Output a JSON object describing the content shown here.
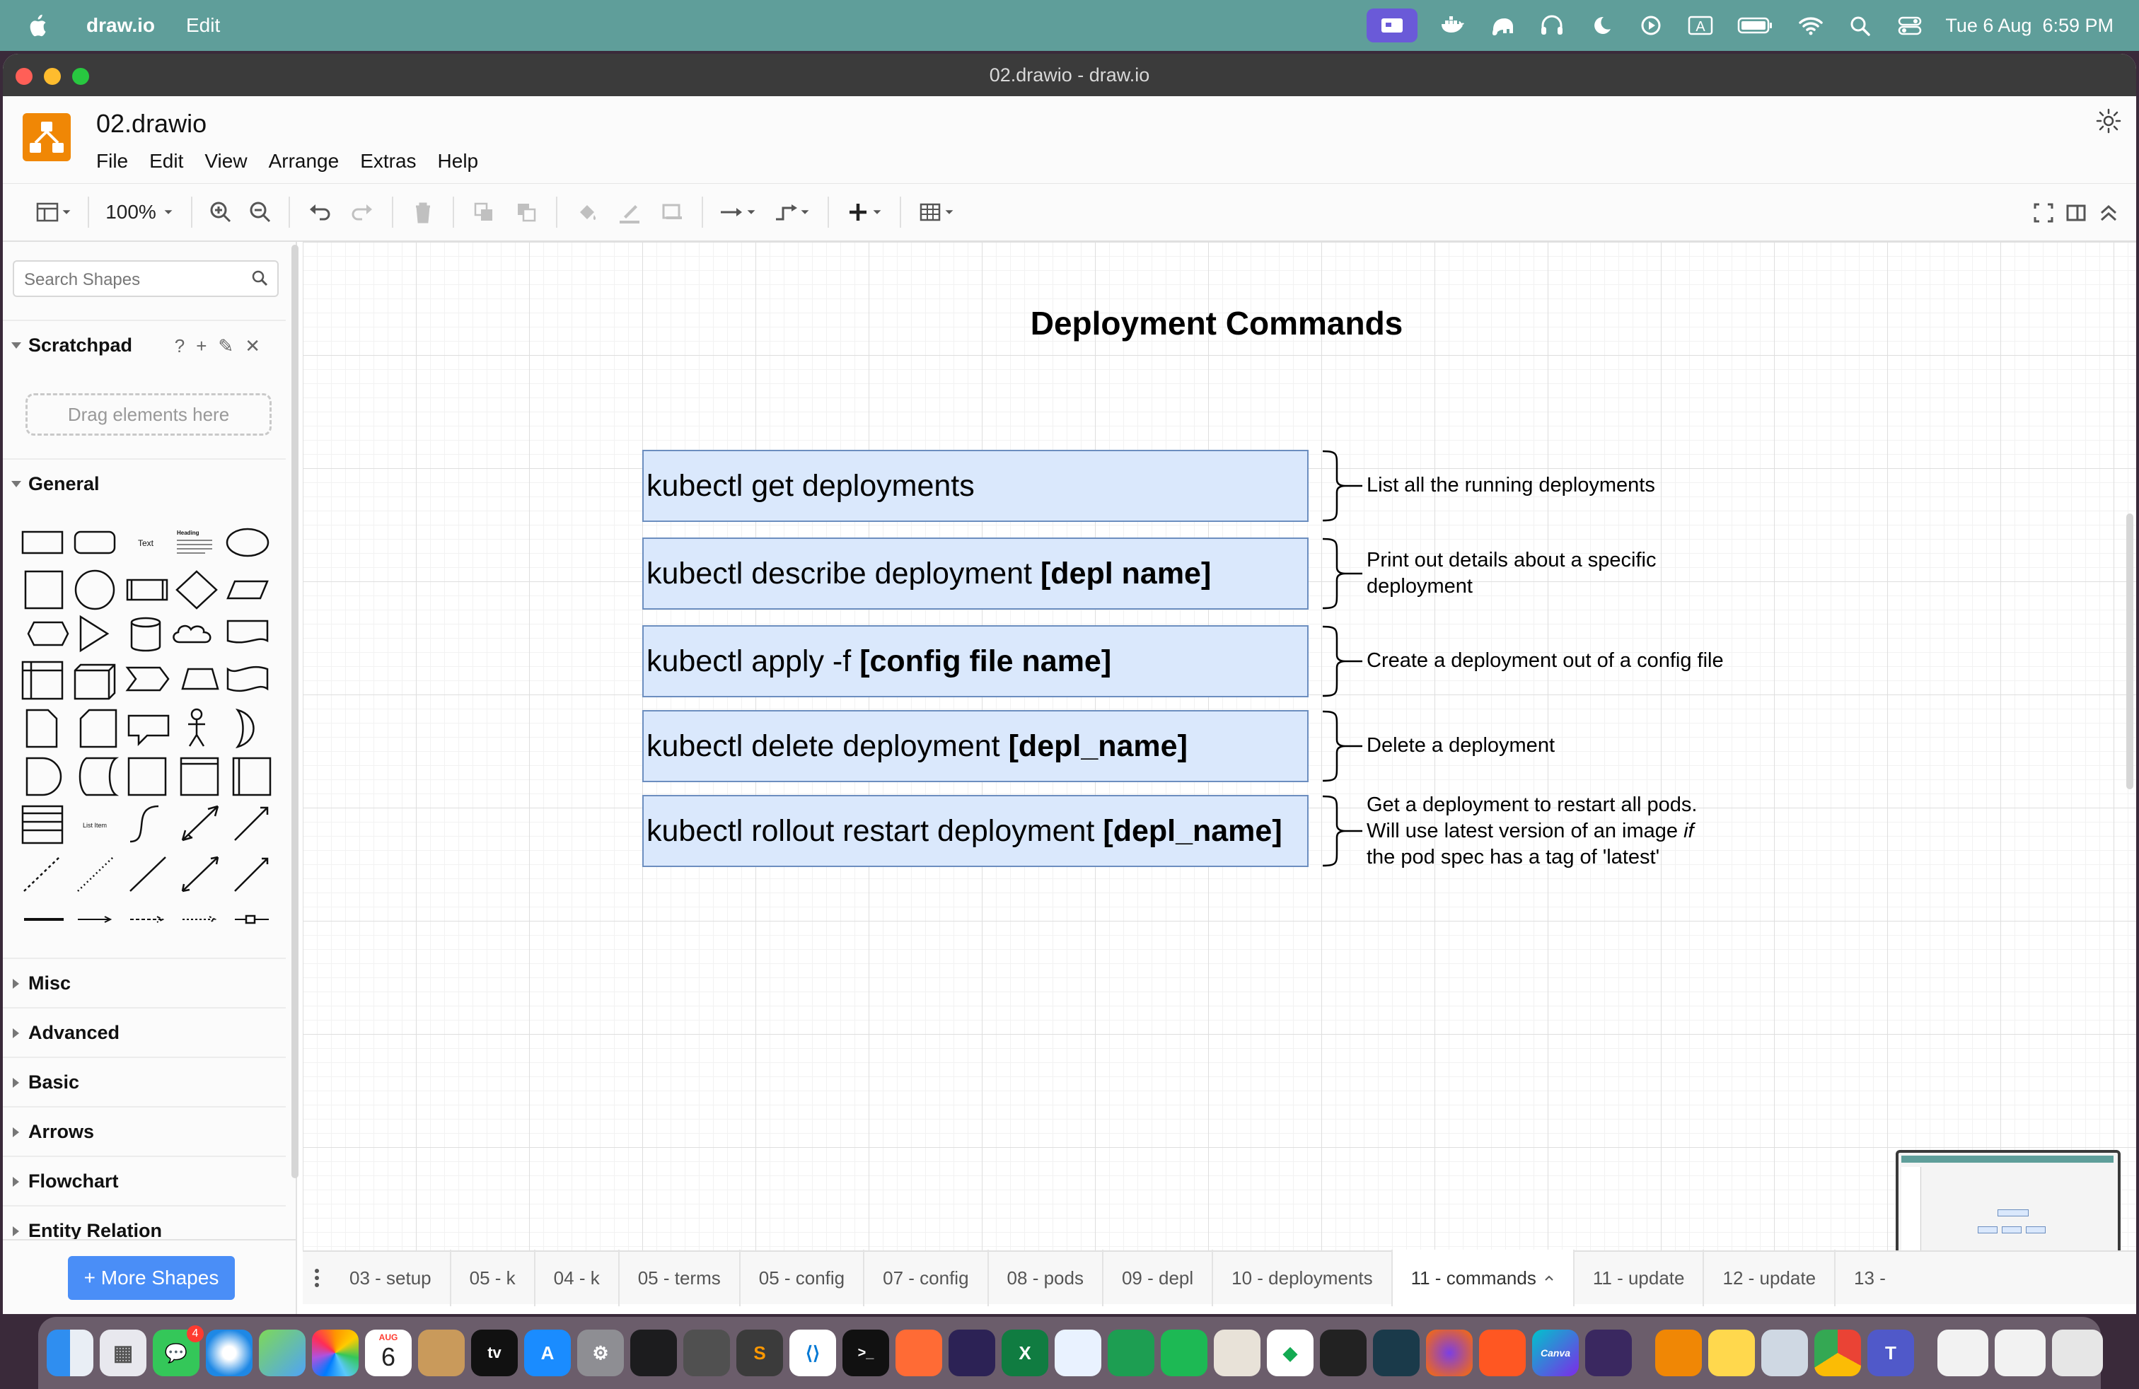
{
  "menubar": {
    "app_name": "draw.io",
    "edit": "Edit",
    "keyboard_indicator": "A",
    "datetime": "Tue 6 Aug  6:59 PM"
  },
  "window": {
    "title": "02.drawio - draw.io"
  },
  "app": {
    "doc_title": "02.drawio",
    "menu": [
      "File",
      "Edit",
      "View",
      "Arrange",
      "Extras",
      "Help"
    ],
    "zoom": "100%"
  },
  "sidebar": {
    "search_placeholder": "Search Shapes",
    "scratchpad": "Scratchpad",
    "scratchpad_help": "?",
    "drop_hint": "Drag elements here",
    "general": "General",
    "shape_text": "Text",
    "shape_heading": "Heading",
    "shape_list_item": "List Item",
    "sections": [
      "Misc",
      "Advanced",
      "Basic",
      "Arrows",
      "Flowchart",
      "Entity Relation"
    ],
    "more_shapes": "+ More Shapes"
  },
  "diagram": {
    "title": "Deployment Commands",
    "commands": [
      {
        "plain": "kubectl get deployments",
        "bold": "",
        "desc": [
          "List all the running deployments"
        ]
      },
      {
        "plain": "kubectl describe deployment",
        "bold": "[depl name]",
        "desc": [
          "Print out details about a specific",
          "deployment"
        ]
      },
      {
        "plain": "kubectl apply -f",
        "bold": "[config file name]",
        "desc": [
          "Create a deployment out of a config file"
        ]
      },
      {
        "plain": "kubectl delete deployment",
        "bold": "[depl_name]",
        "desc": [
          "Delete a deployment"
        ]
      },
      {
        "plain": "kubectl rollout restart deployment",
        "bold": "[depl_name]",
        "desc": [
          "Get a deployment to restart all pods.",
          "Will use latest version of an image",
          "the pod spec has a tag of 'latest'"
        ],
        "desc_italic": "if"
      }
    ]
  },
  "tabs": [
    "03 - setup",
    "05 - k",
    "04 - k",
    "05 - terms",
    "05 - config",
    "07 - config",
    "08 - pods",
    "09 - depl",
    "10 - deployments",
    "11 - commands",
    "11 - update",
    "12 - update",
    "13 -"
  ],
  "active_tab": "11 - commands",
  "dock": {
    "calendar_month": "AUG",
    "calendar_day": "6",
    "messages_badge": "4",
    "tv": "tv",
    "canva": "Canva"
  },
  "colors": {
    "menubar": "#5f9e9a",
    "command_fill": "#dae8fc",
    "command_stroke": "#6c8ebf",
    "drawio_orange": "#f08705",
    "more_shapes_button": "#4a8ef7"
  }
}
